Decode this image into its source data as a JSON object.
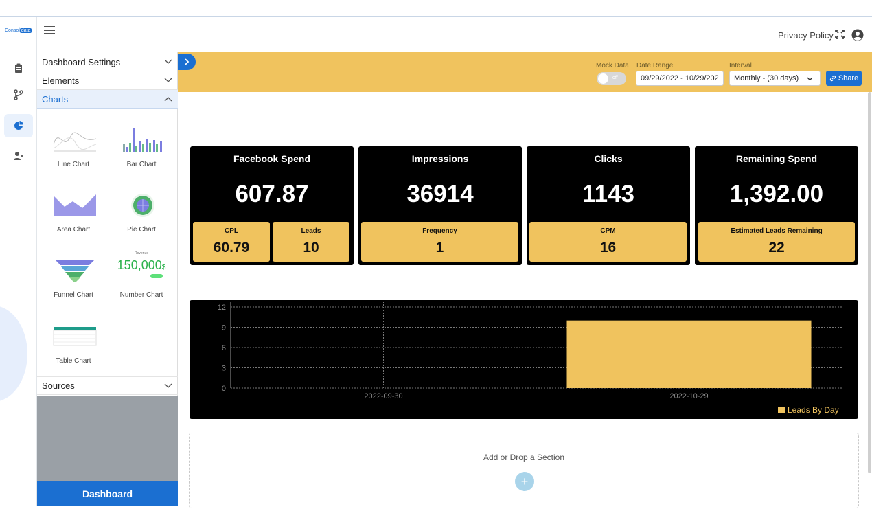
{
  "app": {
    "logo": {
      "text_prefix": "Consol",
      "text_box": "data"
    },
    "privacy_link": "Privacy Policy"
  },
  "sidebar": {
    "sections": [
      {
        "label": "Dashboard Settings",
        "open": false
      },
      {
        "label": "Elements",
        "open": false
      },
      {
        "label": "Charts",
        "open": true
      },
      {
        "label": "Sources",
        "open": false
      }
    ],
    "charts": [
      {
        "label": "Line Chart",
        "icon": "line-chart-thumbnail"
      },
      {
        "label": "Bar Chart",
        "icon": "bar-chart-thumbnail"
      },
      {
        "label": "Area Chart",
        "icon": "area-chart-thumbnail"
      },
      {
        "label": "Pie Chart",
        "icon": "pie-chart-thumbnail"
      },
      {
        "label": "Funnel Chart",
        "icon": "funnel-chart-thumbnail"
      },
      {
        "label": "Number Chart",
        "icon": "number-chart-thumbnail"
      },
      {
        "label": "Table Chart",
        "icon": "table-chart-thumbnail"
      }
    ],
    "number_thumb": {
      "value": "150,000",
      "suffix": "$",
      "title": "Revenue"
    },
    "dashboard_button": "Dashboard"
  },
  "toolbar": {
    "mock_label": "Mock Data",
    "mock_state": "off",
    "date_label": "Date Range",
    "date_value": "09/29/2022 - 10/29/202",
    "interval_label": "Interval",
    "interval_value": "Monthly - (30 days)",
    "share_label": "Share"
  },
  "cards": [
    {
      "title": "Facebook Spend",
      "value": "607.87",
      "subs": [
        {
          "label": "CPL",
          "value": "60.79"
        },
        {
          "label": "Leads",
          "value": "10"
        }
      ]
    },
    {
      "title": "Impressions",
      "value": "36914",
      "subs": [
        {
          "label": "Frequency",
          "value": "1"
        }
      ]
    },
    {
      "title": "Clicks",
      "value": "1143",
      "subs": [
        {
          "label": "CPM",
          "value": "16"
        }
      ]
    },
    {
      "title": "Remaining Spend",
      "value": "1,392.00",
      "subs": [
        {
          "label": "Estimated Leads Remaining",
          "value": "22"
        }
      ]
    }
  ],
  "chart_data": {
    "type": "bar",
    "categories": [
      "2022-09-30",
      "2022-10-29"
    ],
    "series": [
      {
        "name": "Leads By Day",
        "values": [
          0,
          10
        ]
      }
    ],
    "ylim": [
      0,
      12
    ],
    "yticks": [
      0,
      3,
      6,
      9,
      12
    ],
    "grid": true,
    "legend": "bottom-right",
    "colors": {
      "bar": "#f0c35e",
      "background": "#000000",
      "text": "#888888"
    }
  },
  "add_section": {
    "label": "Add or Drop a Section",
    "button": "+"
  },
  "colors": {
    "accent": "#1b6fd1",
    "brand_yellow": "#f0c35e"
  }
}
